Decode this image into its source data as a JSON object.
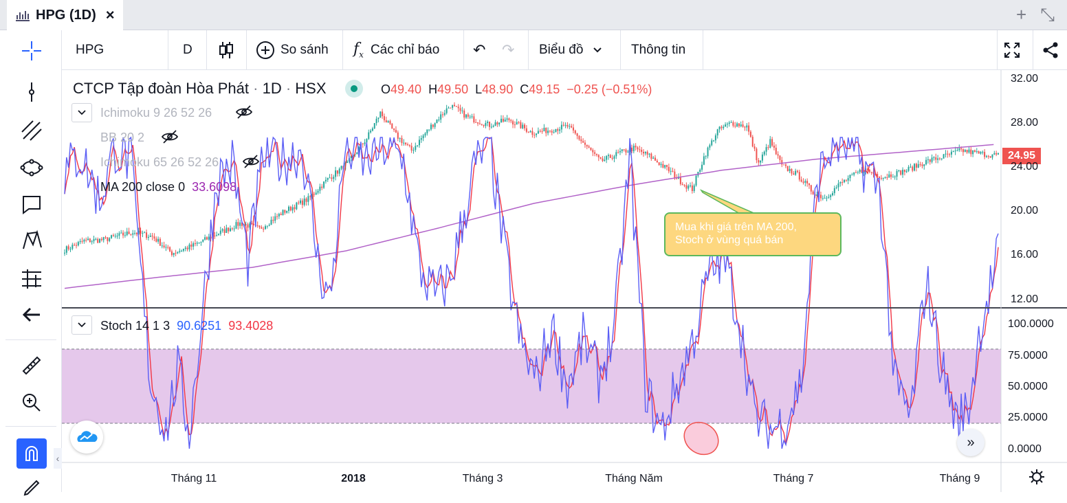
{
  "window": {
    "title": "HPG (1D)",
    "close": "×",
    "add": "+",
    "shrink": "⤡"
  },
  "toolbar": {
    "symbol": "HPG",
    "interval": "D",
    "compare": "So sánh",
    "indicators": "Các chỉ báo",
    "chart_type": "Biểu đồ",
    "info": "Thông tin"
  },
  "header": {
    "name": "CTCP Tập đoàn Hòa Phát",
    "interval": "1D",
    "exchange": "HSX",
    "sep": "·",
    "ohlc": {
      "o_label": "O",
      "o": "49.40",
      "h_label": "H",
      "h": "49.50",
      "l_label": "L",
      "l": "48.90",
      "c_label": "C",
      "c": "49.15",
      "change": "−0.25 (−0.51%)"
    }
  },
  "indicators": [
    {
      "name": "Ichimoku 9 26 52 26",
      "hidden": true
    },
    {
      "name": "BB 20 2",
      "hidden": true
    },
    {
      "name": "Ichimoku 65 26 52 26",
      "hidden": true
    },
    {
      "name": "MA 200 close 0",
      "value": "33.6098",
      "color": "#9c27b0"
    }
  ],
  "stoch": {
    "name": "Stoch 14 1 3",
    "k": "90.6251",
    "d": "93.4028",
    "k_color": "#2962ff",
    "d_color": "#f23645"
  },
  "annotation": {
    "line1": "Mua khi giá trên MA 200,",
    "line2": "Stoch ở vùng quá bán"
  },
  "last_price": "24.95",
  "price_axis": [
    "32.00",
    "28.00",
    "24.00",
    "20.00",
    "16.00",
    "12.00"
  ],
  "stoch_axis": [
    "100.0000",
    "75.0000",
    "50.0000",
    "25.0000",
    "0.0000"
  ],
  "time_axis": [
    "Tháng 11",
    "2018",
    "Tháng 3",
    "Tháng Năm",
    "Tháng 7",
    "Tháng 9"
  ],
  "colors": {
    "up": "#26a69a",
    "down": "#ef5350",
    "ma": "#b162c8",
    "stoch_band": "#e1bee7"
  },
  "chart_data": {
    "type": "candlestick",
    "price_range": [
      12,
      32
    ],
    "stoch_range": [
      0,
      100
    ],
    "overbought": 80,
    "oversold": 20,
    "close_anchors": [
      [
        0,
        16.4
      ],
      [
        10,
        17.2
      ],
      [
        20,
        17.3
      ],
      [
        35,
        18.0
      ],
      [
        45,
        17.6
      ],
      [
        55,
        16.1
      ],
      [
        65,
        16.7
      ],
      [
        78,
        17.8
      ],
      [
        90,
        18.8
      ],
      [
        100,
        18.3
      ],
      [
        112,
        19.8
      ],
      [
        125,
        21.0
      ],
      [
        135,
        22.8
      ],
      [
        145,
        24.2
      ],
      [
        155,
        26.5
      ],
      [
        162,
        28.8
      ],
      [
        170,
        26.8
      ],
      [
        178,
        25.4
      ],
      [
        188,
        27.6
      ],
      [
        198,
        29.5
      ],
      [
        207,
        28.4
      ],
      [
        218,
        27.7
      ],
      [
        228,
        28.2
      ],
      [
        240,
        27.0
      ],
      [
        250,
        27.3
      ],
      [
        258,
        27.6
      ],
      [
        265,
        26.3
      ],
      [
        275,
        24.4
      ],
      [
        285,
        25.2
      ],
      [
        292,
        25.6
      ],
      [
        300,
        24.9
      ],
      [
        310,
        23.6
      ],
      [
        318,
        22.3
      ],
      [
        322,
        21.9
      ],
      [
        328,
        24.8
      ],
      [
        335,
        27.2
      ],
      [
        342,
        27.9
      ],
      [
        350,
        27.6
      ],
      [
        356,
        24.2
      ],
      [
        362,
        26.2
      ],
      [
        368,
        24.0
      ],
      [
        376,
        23.2
      ],
      [
        384,
        21.6
      ],
      [
        390,
        21.1
      ],
      [
        398,
        22.4
      ],
      [
        410,
        23.7
      ],
      [
        420,
        23.0
      ],
      [
        432,
        23.6
      ],
      [
        442,
        24.4
      ],
      [
        452,
        24.9
      ],
      [
        460,
        25.4
      ],
      [
        470,
        25.1
      ],
      [
        479,
        24.95
      ]
    ],
    "ma200_anchors": [
      [
        0,
        12.9
      ],
      [
        100,
        13.9
      ],
      [
        200,
        14.8
      ],
      [
        300,
        16.3
      ],
      [
        400,
        18.4
      ],
      [
        500,
        20.6
      ],
      [
        600,
        22.2
      ],
      [
        700,
        23.6
      ],
      [
        800,
        24.6
      ],
      [
        1000,
        26.0
      ]
    ],
    "stoch_k_anchors": [
      [
        0,
        88
      ],
      [
        8,
        95
      ],
      [
        18,
        80
      ],
      [
        26,
        97
      ],
      [
        34,
        92
      ],
      [
        44,
        22
      ],
      [
        52,
        6
      ],
      [
        58,
        25
      ],
      [
        64,
        5
      ],
      [
        70,
        40
      ],
      [
        78,
        86
      ],
      [
        86,
        92
      ],
      [
        94,
        60
      ],
      [
        102,
        94
      ],
      [
        112,
        93
      ],
      [
        122,
        96
      ],
      [
        130,
        60
      ],
      [
        136,
        47
      ],
      [
        144,
        97
      ],
      [
        154,
        92
      ],
      [
        164,
        97
      ],
      [
        174,
        92
      ],
      [
        182,
        58
      ],
      [
        190,
        49
      ],
      [
        198,
        55
      ],
      [
        210,
        90
      ],
      [
        218,
        98
      ],
      [
        226,
        62
      ],
      [
        234,
        33
      ],
      [
        242,
        22
      ],
      [
        250,
        39
      ],
      [
        258,
        20
      ],
      [
        266,
        35
      ],
      [
        274,
        23
      ],
      [
        282,
        38
      ],
      [
        290,
        94
      ],
      [
        298,
        20
      ],
      [
        306,
        5
      ],
      [
        314,
        20
      ],
      [
        322,
        34
      ],
      [
        330,
        55
      ],
      [
        338,
        62
      ],
      [
        346,
        42
      ],
      [
        354,
        10
      ],
      [
        362,
        6
      ],
      [
        370,
        9
      ],
      [
        378,
        22
      ],
      [
        386,
        86
      ],
      [
        394,
        98
      ],
      [
        402,
        97
      ],
      [
        410,
        91
      ],
      [
        418,
        84
      ],
      [
        426,
        20
      ],
      [
        434,
        10
      ],
      [
        442,
        55
      ],
      [
        450,
        26
      ],
      [
        458,
        8
      ],
      [
        464,
        14
      ],
      [
        470,
        40
      ],
      [
        479,
        62
      ]
    ]
  }
}
